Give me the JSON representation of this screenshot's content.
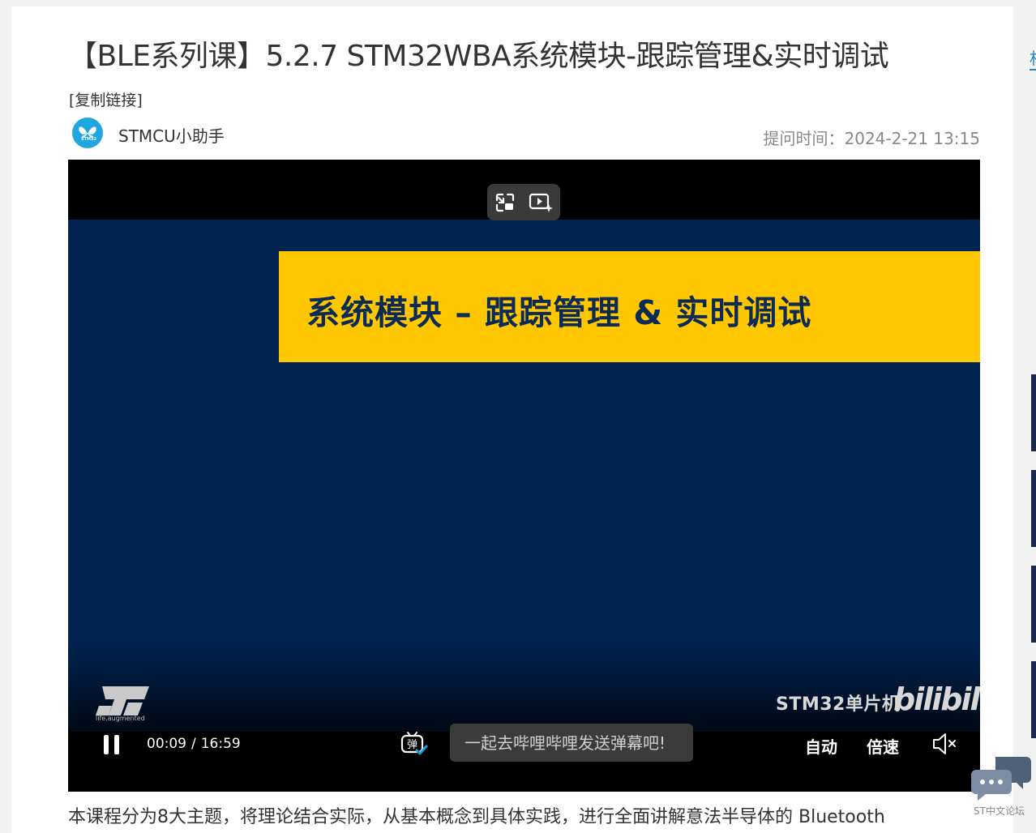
{
  "article": {
    "title": "【BLE系列课】5.2.7 STM32WBA系统模块-跟踪管理&实时调试",
    "copy_link": "[复制链接]",
    "author": "STMCU小助手",
    "avatar_tag": "STM32",
    "post_time": "提问时间：2024-2-21 13:15",
    "description": "本课程分为8大主题，将理论结合实际，从基本概念到具体实践，进行全面讲解意法半导体的 Bluetooth"
  },
  "video": {
    "slide_title": "系统模块 – 跟踪管理 & 实时调试",
    "st_tagline": "life.augmented",
    "watermark": "STM32单片机",
    "platform_logo": "bilibili",
    "current_time": "00:09",
    "separator": "/",
    "duration": "16:59",
    "danmaku_icon_label": "弹",
    "danmaku_placeholder": "一起去哔哩哔哩发送弹幕吧!",
    "quality_label": "自动",
    "speed_label": "倍速",
    "colors": {
      "slide_bg": "#002352",
      "banner": "#ffc700",
      "avatar": "#1fa7e1"
    }
  },
  "sidebar": {
    "link_text": "相",
    "forum_label": "ST中文论坛"
  }
}
